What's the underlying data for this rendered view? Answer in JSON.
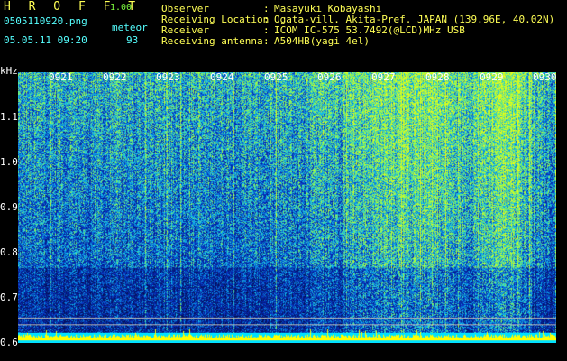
{
  "header": {
    "title": "H R O F F T",
    "version": "1.00",
    "filename": "0505110920.png",
    "mode": "meteor",
    "timestamp": "05.05.11 09:20",
    "count": "93"
  },
  "info": [
    {
      "label": "Observer",
      "colon": ":",
      "value": "Masayuki Kobayashi"
    },
    {
      "label": "Receiving Location",
      "colon": ":",
      "value": "Ogata-vill. Akita-Pref. JAPAN (139.96E, 40.02N)"
    },
    {
      "label": "Receiver",
      "colon": ":",
      "value": "ICOM IC-575 53.7492(@LCD)MHz USB"
    },
    {
      "label": "Receiving antenna",
      "colon": ":",
      "value": "A504HB(yagi 4el)"
    }
  ],
  "axis": {
    "y_unit": "kHz",
    "y_ticks": [
      "1.1",
      "1.0",
      "0.9",
      "0.8",
      "0.7",
      "0.6"
    ],
    "x_ticks": [
      "0921",
      "0922",
      "0923",
      "0924",
      "0925",
      "0926",
      "0927",
      "0928",
      "0929",
      "0930"
    ]
  },
  "colors": {
    "background": "#000000",
    "header_yellow": "#ffff55",
    "header_cyan": "#55ffff",
    "spectro_low": "#0a1a6e",
    "spectro_high": "#c8ff40",
    "baseline_trace": "#ffff00",
    "baseline_fill": "#00e0ff"
  }
}
